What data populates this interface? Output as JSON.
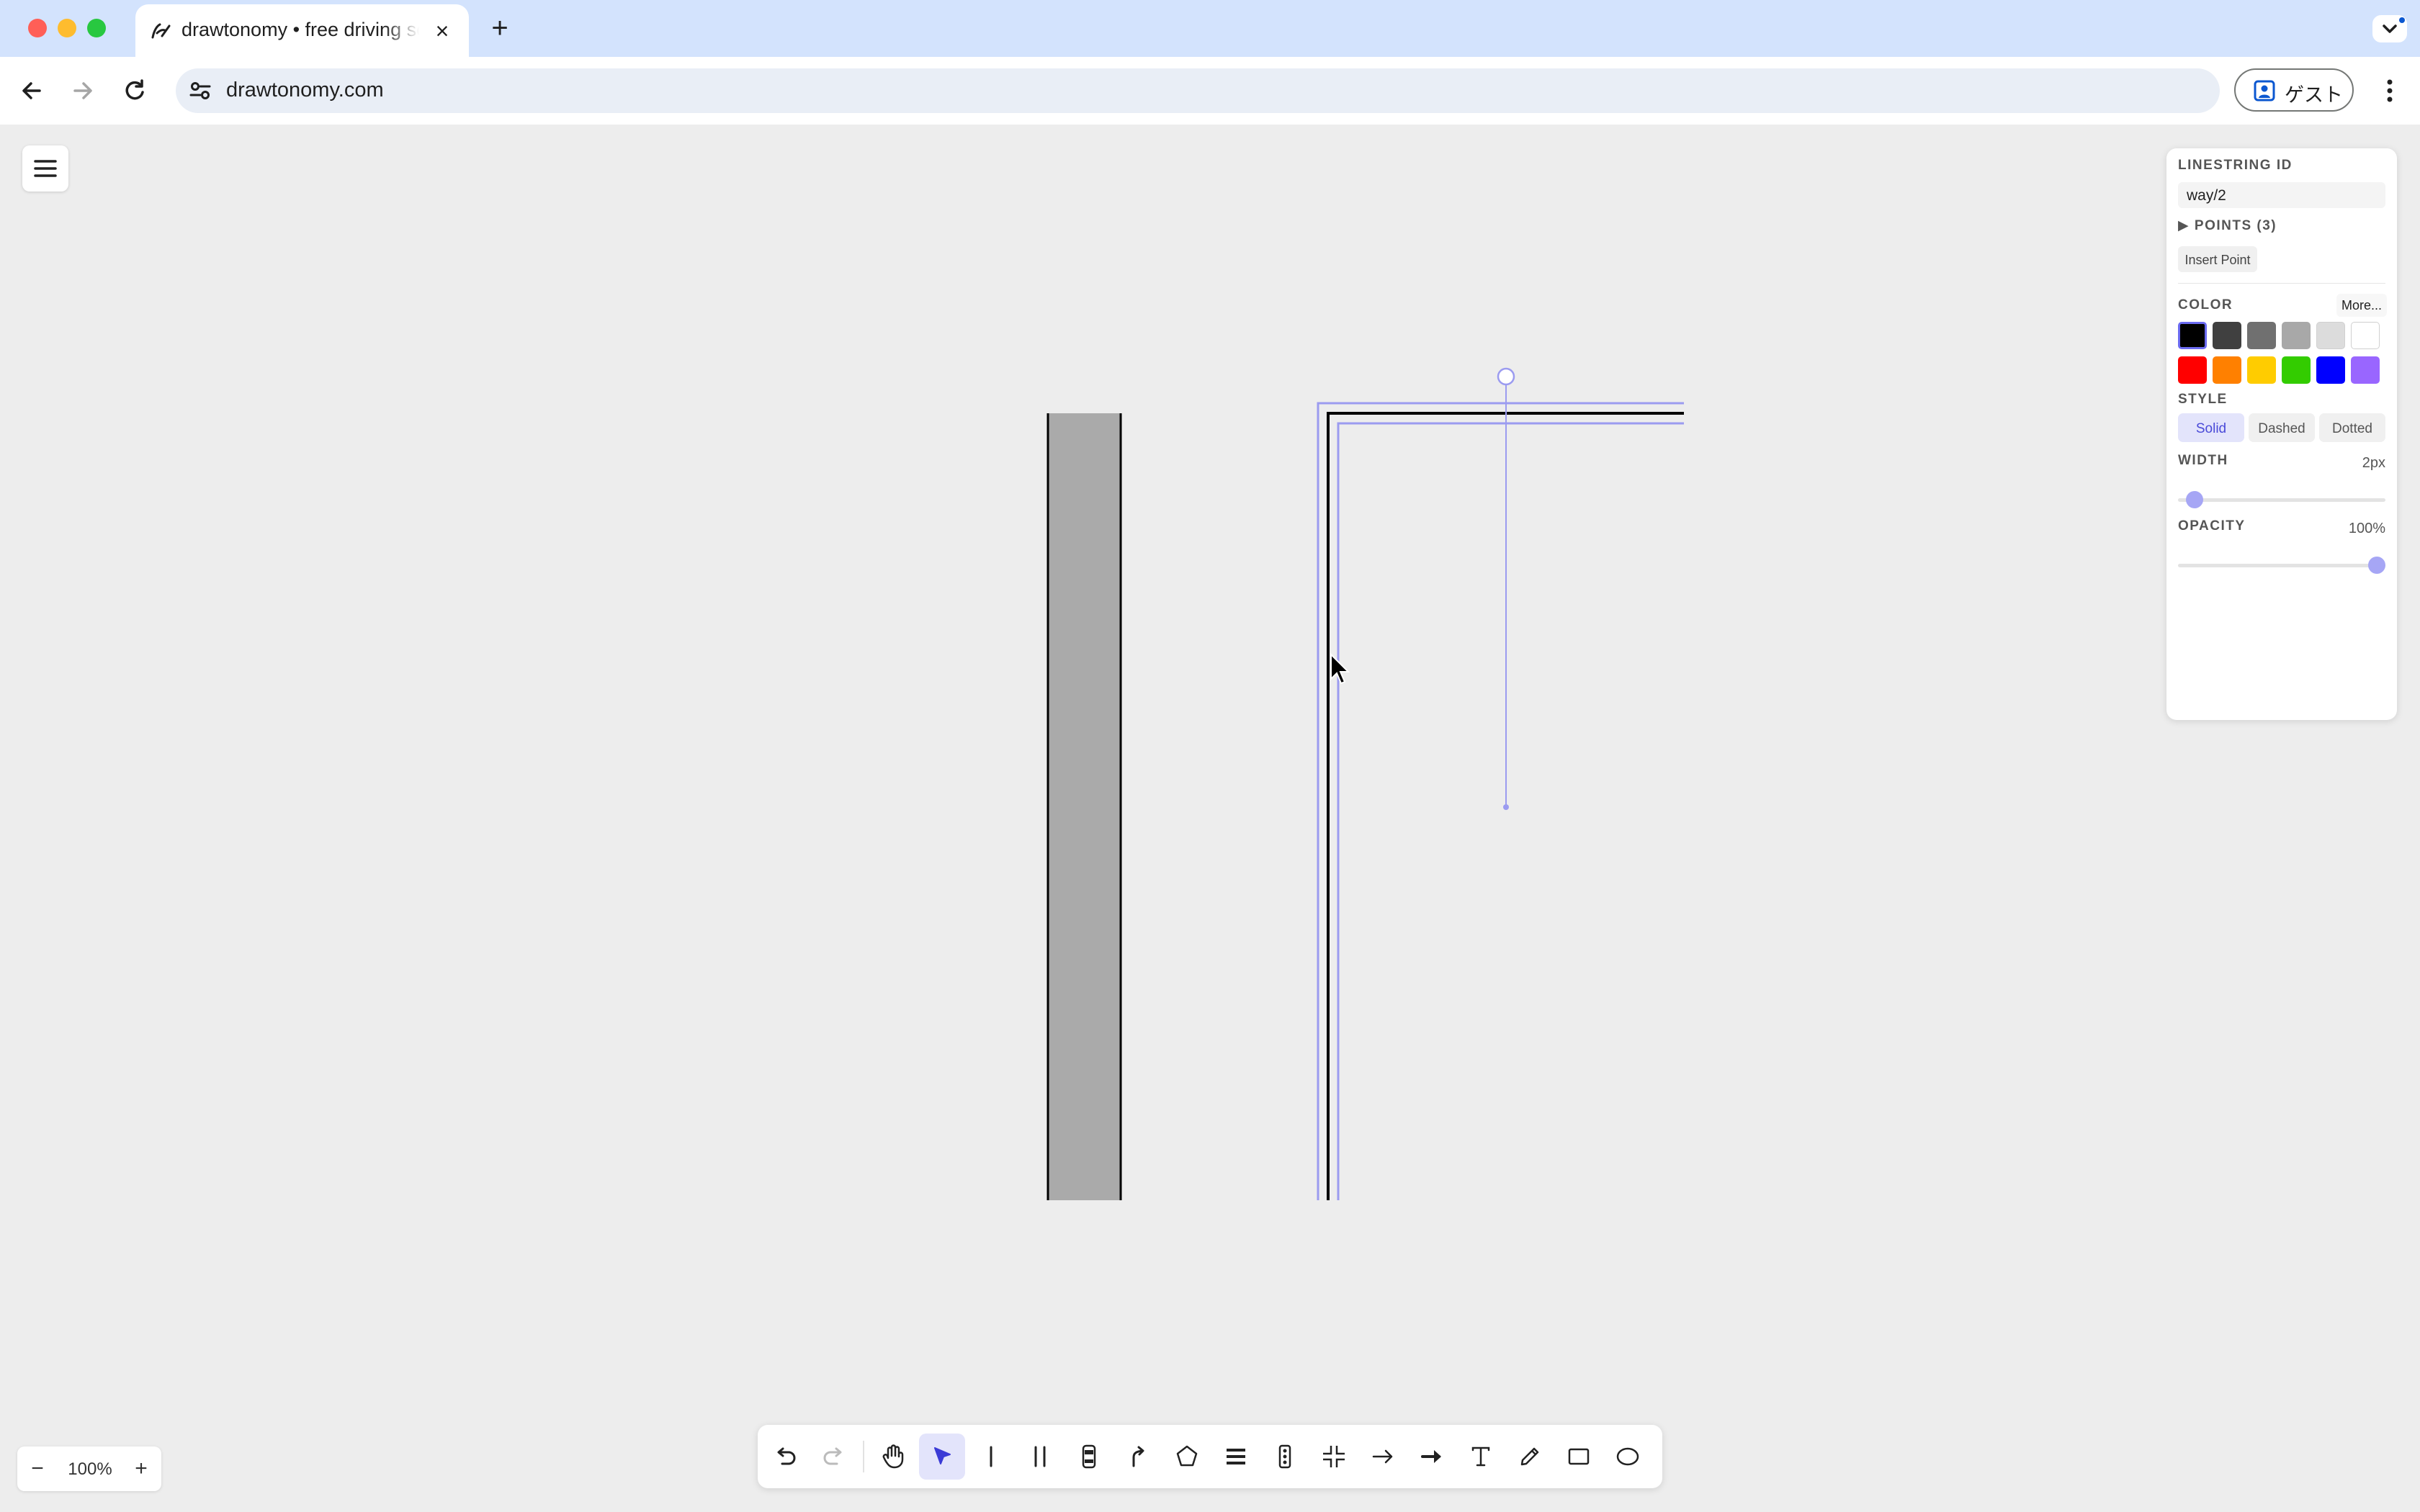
{
  "browser": {
    "tab_title": "drawtonomy • free driving scenario",
    "url": "drawtonomy.com",
    "profile_label": "ゲスト"
  },
  "panel": {
    "id_label": "LINESTRING ID",
    "id_value": "way/2",
    "points_label": "▶ POINTS (3)",
    "insert_point": "Insert Point",
    "color_label": "COLOR",
    "more_label": "More...",
    "colors": [
      "#000000",
      "#404040",
      "#707070",
      "#a8a8a8",
      "#dcdcdc",
      "#ffffff",
      "#ff0000",
      "#ff8000",
      "#ffcc00",
      "#33cc00",
      "#0000ff",
      "#9966ff"
    ],
    "selected_color": "#000000",
    "style_label": "STYLE",
    "styles": [
      "Solid",
      "Dashed",
      "Dotted"
    ],
    "selected_style": "Solid",
    "width_label": "WIDTH",
    "width_value": "2px",
    "width_slider_fraction": 0.04,
    "opacity_label": "OPACITY",
    "opacity_value": "100%",
    "opacity_slider_fraction": 1.0
  },
  "zoom": {
    "minus": "−",
    "level": "100%",
    "plus": "+"
  },
  "toolbar": {
    "active_tool": "select-tool",
    "tools": [
      "undo-icon",
      "redo-icon",
      "hand-icon",
      "select-arrow-icon",
      "single-lane-icon",
      "double-lane-icon",
      "vehicle-icon",
      "path-icon",
      "polygon-icon",
      "crosswalk-icon",
      "traffic-light-icon",
      "intersection-icon",
      "arrow-icon",
      "thick-arrow-icon",
      "text-icon",
      "pencil-icon",
      "rectangle-icon",
      "ellipse-icon"
    ]
  },
  "colors": {
    "accent": "#6b6bf0",
    "selection": "#9b9bf0",
    "road_fill": "#aaaaaa",
    "canvas_bg": "#ededed"
  }
}
